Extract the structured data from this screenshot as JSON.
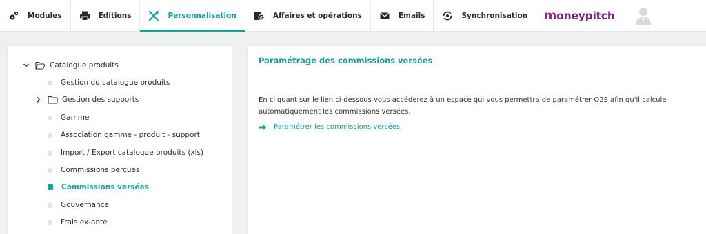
{
  "nav": {
    "tabs": [
      {
        "label": "Modules",
        "icon": "gears-icon"
      },
      {
        "label": "Editions",
        "icon": "printer-icon"
      },
      {
        "label": "Personnalisation",
        "icon": "tools-icon",
        "active": true
      },
      {
        "label": "Affaires et opérations",
        "icon": "money-icon"
      },
      {
        "label": "Emails",
        "icon": "envelope-icon"
      },
      {
        "label": "Synchronisation",
        "icon": "sync-icon"
      }
    ],
    "brand": "moneypitch",
    "user_icon": "user-avatar-icon"
  },
  "tree": {
    "root": {
      "label": "Catalogue produits",
      "expanded": true
    },
    "items": [
      {
        "label": "Gestion du catalogue produits",
        "type": "leaf"
      },
      {
        "label": "Gestion des supports",
        "type": "folder"
      },
      {
        "label": "Gamme",
        "type": "leaf"
      },
      {
        "label": "Association gamme - produit - support",
        "type": "leaf"
      },
      {
        "label": "Import / Export catalogue produits (xls)",
        "type": "leaf"
      },
      {
        "label": "Commissions perçues",
        "type": "leaf"
      },
      {
        "label": "Commissions versées",
        "type": "leaf",
        "active": true
      },
      {
        "label": "Gouvernance",
        "type": "leaf"
      },
      {
        "label": "Frais ex-ante",
        "type": "leaf"
      }
    ]
  },
  "content": {
    "title": "Paramétrage des commissions versées",
    "description": "En cliquant sur le lien ci-dessous vous accéderez à un espace qui vous permettra de paramétrer O2S afin qu'il calcule automatiquement les commissions versées.",
    "link": "Paramétrer les commissions versées"
  },
  "colors": {
    "accent": "#17a39b",
    "brand_purple": "#6e2a78",
    "brand_pink": "#b01d6a"
  }
}
